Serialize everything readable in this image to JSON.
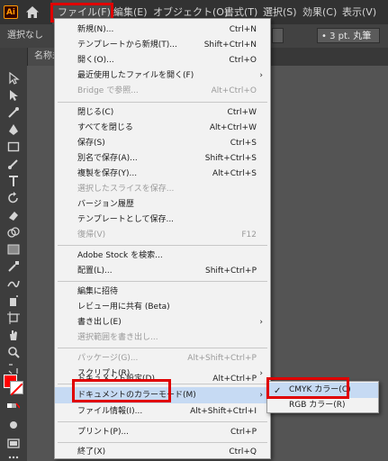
{
  "app_logo": "Ai",
  "menubar": {
    "items": [
      "ファイル(F)",
      "編集(E)",
      "オブジェクト(O)",
      "書式(T)",
      "選択(S)",
      "効果(C)",
      "表示(V)"
    ]
  },
  "controlbar": {
    "selection_label": "選択なし",
    "stroke_dropdown": "3 pt. 丸筆"
  },
  "doc_tab": "名称未",
  "file_menu": [
    {
      "label": "新規(N)...",
      "shortcut": "Ctrl+N"
    },
    {
      "label": "テンプレートから新規(T)...",
      "shortcut": "Shift+Ctrl+N"
    },
    {
      "label": "開く(O)...",
      "shortcut": "Ctrl+O"
    },
    {
      "label": "最近使用したファイルを開く(F)",
      "shortcut": ""
    },
    {
      "label": "Bridge で参照...",
      "shortcut": "Alt+Ctrl+O"
    },
    {
      "label": "閉じる(C)",
      "shortcut": "Ctrl+W"
    },
    {
      "label": "すべてを閉じる",
      "shortcut": "Alt+Ctrl+W"
    },
    {
      "label": "保存(S)",
      "shortcut": "Ctrl+S"
    },
    {
      "label": "別名で保存(A)...",
      "shortcut": "Shift+Ctrl+S"
    },
    {
      "label": "複製を保存(Y)...",
      "shortcut": "Alt+Ctrl+S"
    },
    {
      "label": "選択したスライスを保存...",
      "shortcut": ""
    },
    {
      "label": "バージョン履歴",
      "shortcut": ""
    },
    {
      "label": "テンプレートとして保存...",
      "shortcut": ""
    },
    {
      "label": "復帰(V)",
      "shortcut": "F12"
    },
    {
      "label": "Adobe Stock を検索...",
      "shortcut": ""
    },
    {
      "label": "配置(L)...",
      "shortcut": "Shift+Ctrl+P"
    },
    {
      "label": "編集に招待",
      "shortcut": ""
    },
    {
      "label": "レビュー用に共有 (Beta)",
      "shortcut": ""
    },
    {
      "label": "書き出し(E)",
      "shortcut": ""
    },
    {
      "label": "選択範囲を書き出し...",
      "shortcut": ""
    },
    {
      "label": "パッケージ(G)...",
      "shortcut": "Alt+Shift+Ctrl+P"
    },
    {
      "label": "スクリプト(R)",
      "shortcut": ""
    },
    {
      "label": "ドキュメント設定(D)...",
      "shortcut": "Alt+Ctrl+P"
    },
    {
      "label": "ドキュメントのカラーモード(M)",
      "shortcut": ""
    },
    {
      "label": "ファイル情報(I)...",
      "shortcut": "Alt+Shift+Ctrl+I"
    },
    {
      "label": "プリント(P)...",
      "shortcut": "Ctrl+P"
    },
    {
      "label": "終了(X)",
      "shortcut": "Ctrl+Q"
    }
  ],
  "color_mode_submenu": [
    {
      "label": "CMYK カラー(C)",
      "checked": true
    },
    {
      "label": "RGB カラー(R)",
      "checked": false
    }
  ],
  "colors": {
    "highlight_box": "#e00000",
    "menu_hover": "#c6daf3",
    "logo_orange": "#ff9a00"
  }
}
